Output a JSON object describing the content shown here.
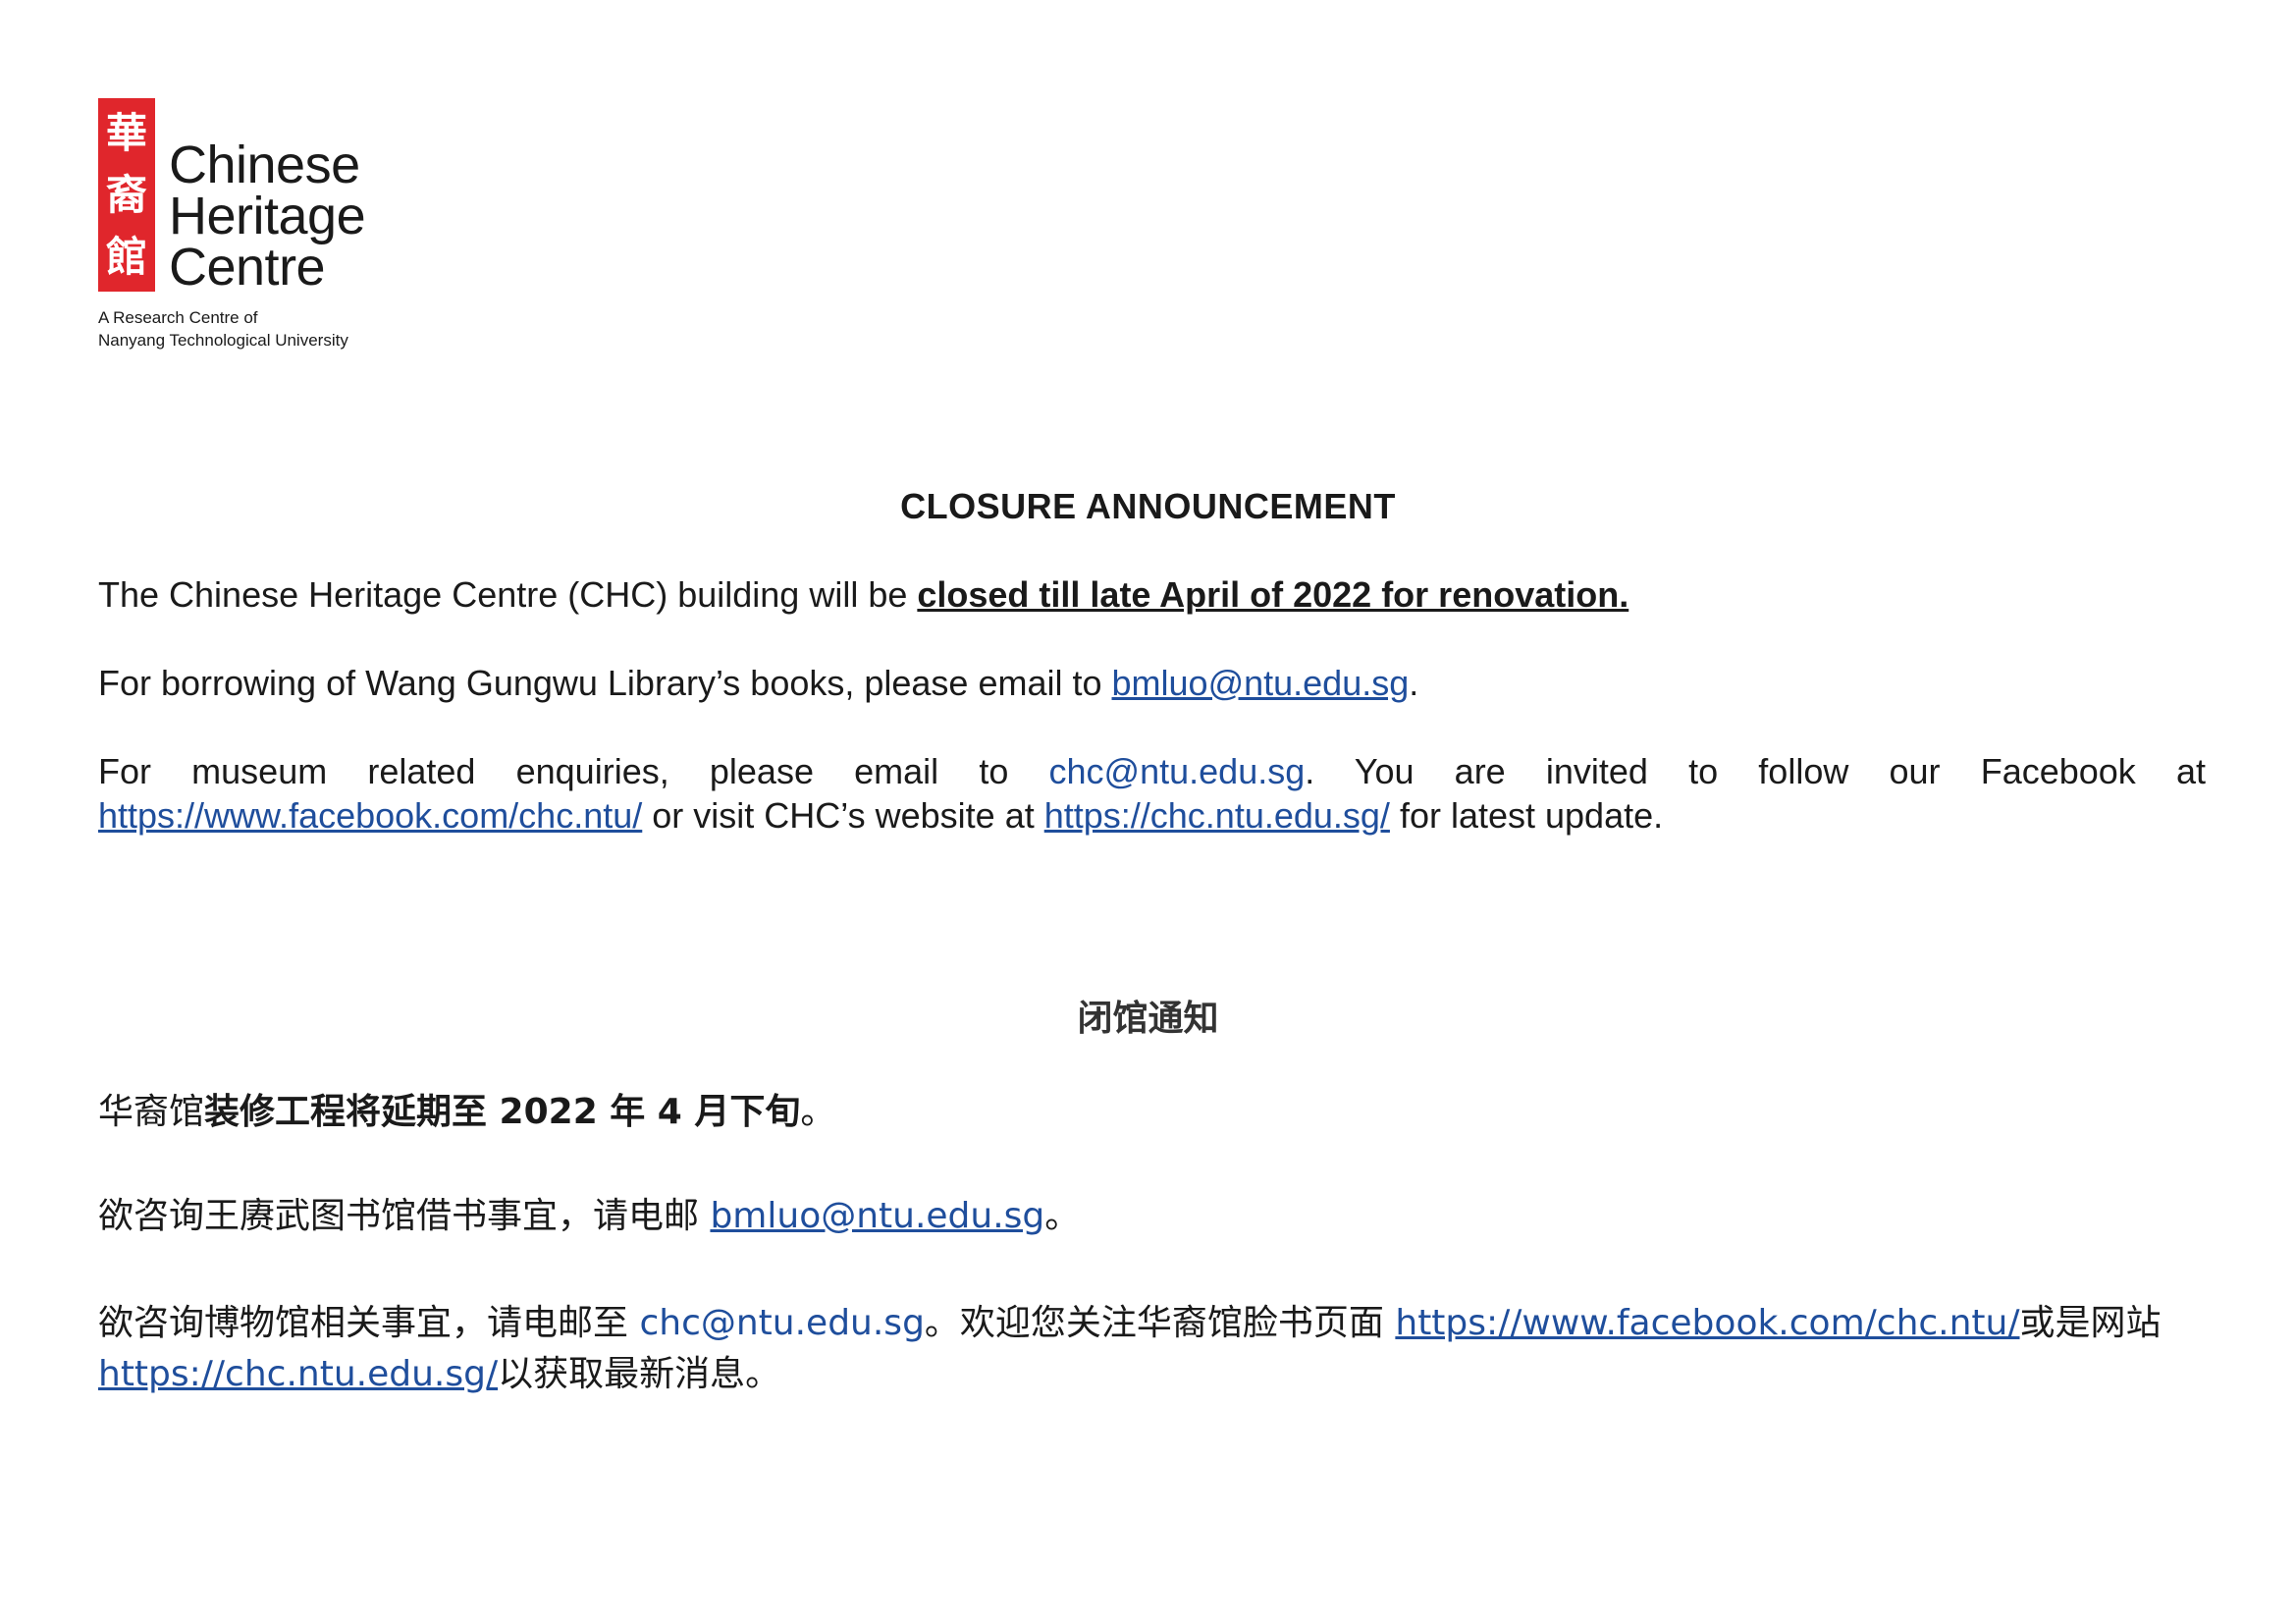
{
  "logo": {
    "seal_chars": [
      "華",
      "裔",
      "館"
    ],
    "name_lines": [
      "Chinese",
      "Heritage",
      "Centre"
    ],
    "sub_lines": [
      "A Research Centre of",
      "Nanyang Technological University"
    ],
    "seal_color": "#e0262c"
  },
  "english": {
    "title": "CLOSURE ANNOUNCEMENT",
    "p1_prefix": "The Chinese Heritage Centre (CHC) building will be ",
    "p1_bold": "closed till late April of 2022 for renovation.",
    "p2_prefix": "For borrowing of Wang Gungwu Library’s books, please email to ",
    "p2_email": "bmluo@ntu.edu.sg",
    "p2_suffix": ".",
    "p3_prefix": "For museum related enquiries, please email to ",
    "p3_email": "chc@ntu.edu.sg",
    "p3_mid": ". You are invited to follow our Facebook at ",
    "p3_facebook": "https://www.facebook.com/chc.ntu/",
    "p3_mid2": " or visit CHC’s website at ",
    "p3_website": "https://chc.ntu.edu.sg/",
    "p3_suffix": " for latest update."
  },
  "chinese": {
    "title": "闭馆通知",
    "p1_prefix": "华裔馆",
    "p1_bold": "装修工程将延期至 2022 年 4 月下旬",
    "p1_suffix": "。",
    "p2_prefix": "欲咨询王赓武图书馆借书事宜，请电邮 ",
    "p2_email": "bmluo@ntu.edu.sg",
    "p2_suffix": "。",
    "p3_prefix": "欲咨询博物馆相关事宜，请电邮至 ",
    "p3_email": "chc@ntu.edu.sg",
    "p3_mid": "。欢迎您关注华裔馆脸书页面 ",
    "p3_facebook": "https://www.facebook.com/chc.ntu/",
    "p3_mid2": "或是网站",
    "p3_website": "https://chc.ntu.edu.sg/",
    "p3_suffix": "以获取最新消息。"
  },
  "colors": {
    "link": "#1f4e9c",
    "text": "#1a1a1a"
  }
}
